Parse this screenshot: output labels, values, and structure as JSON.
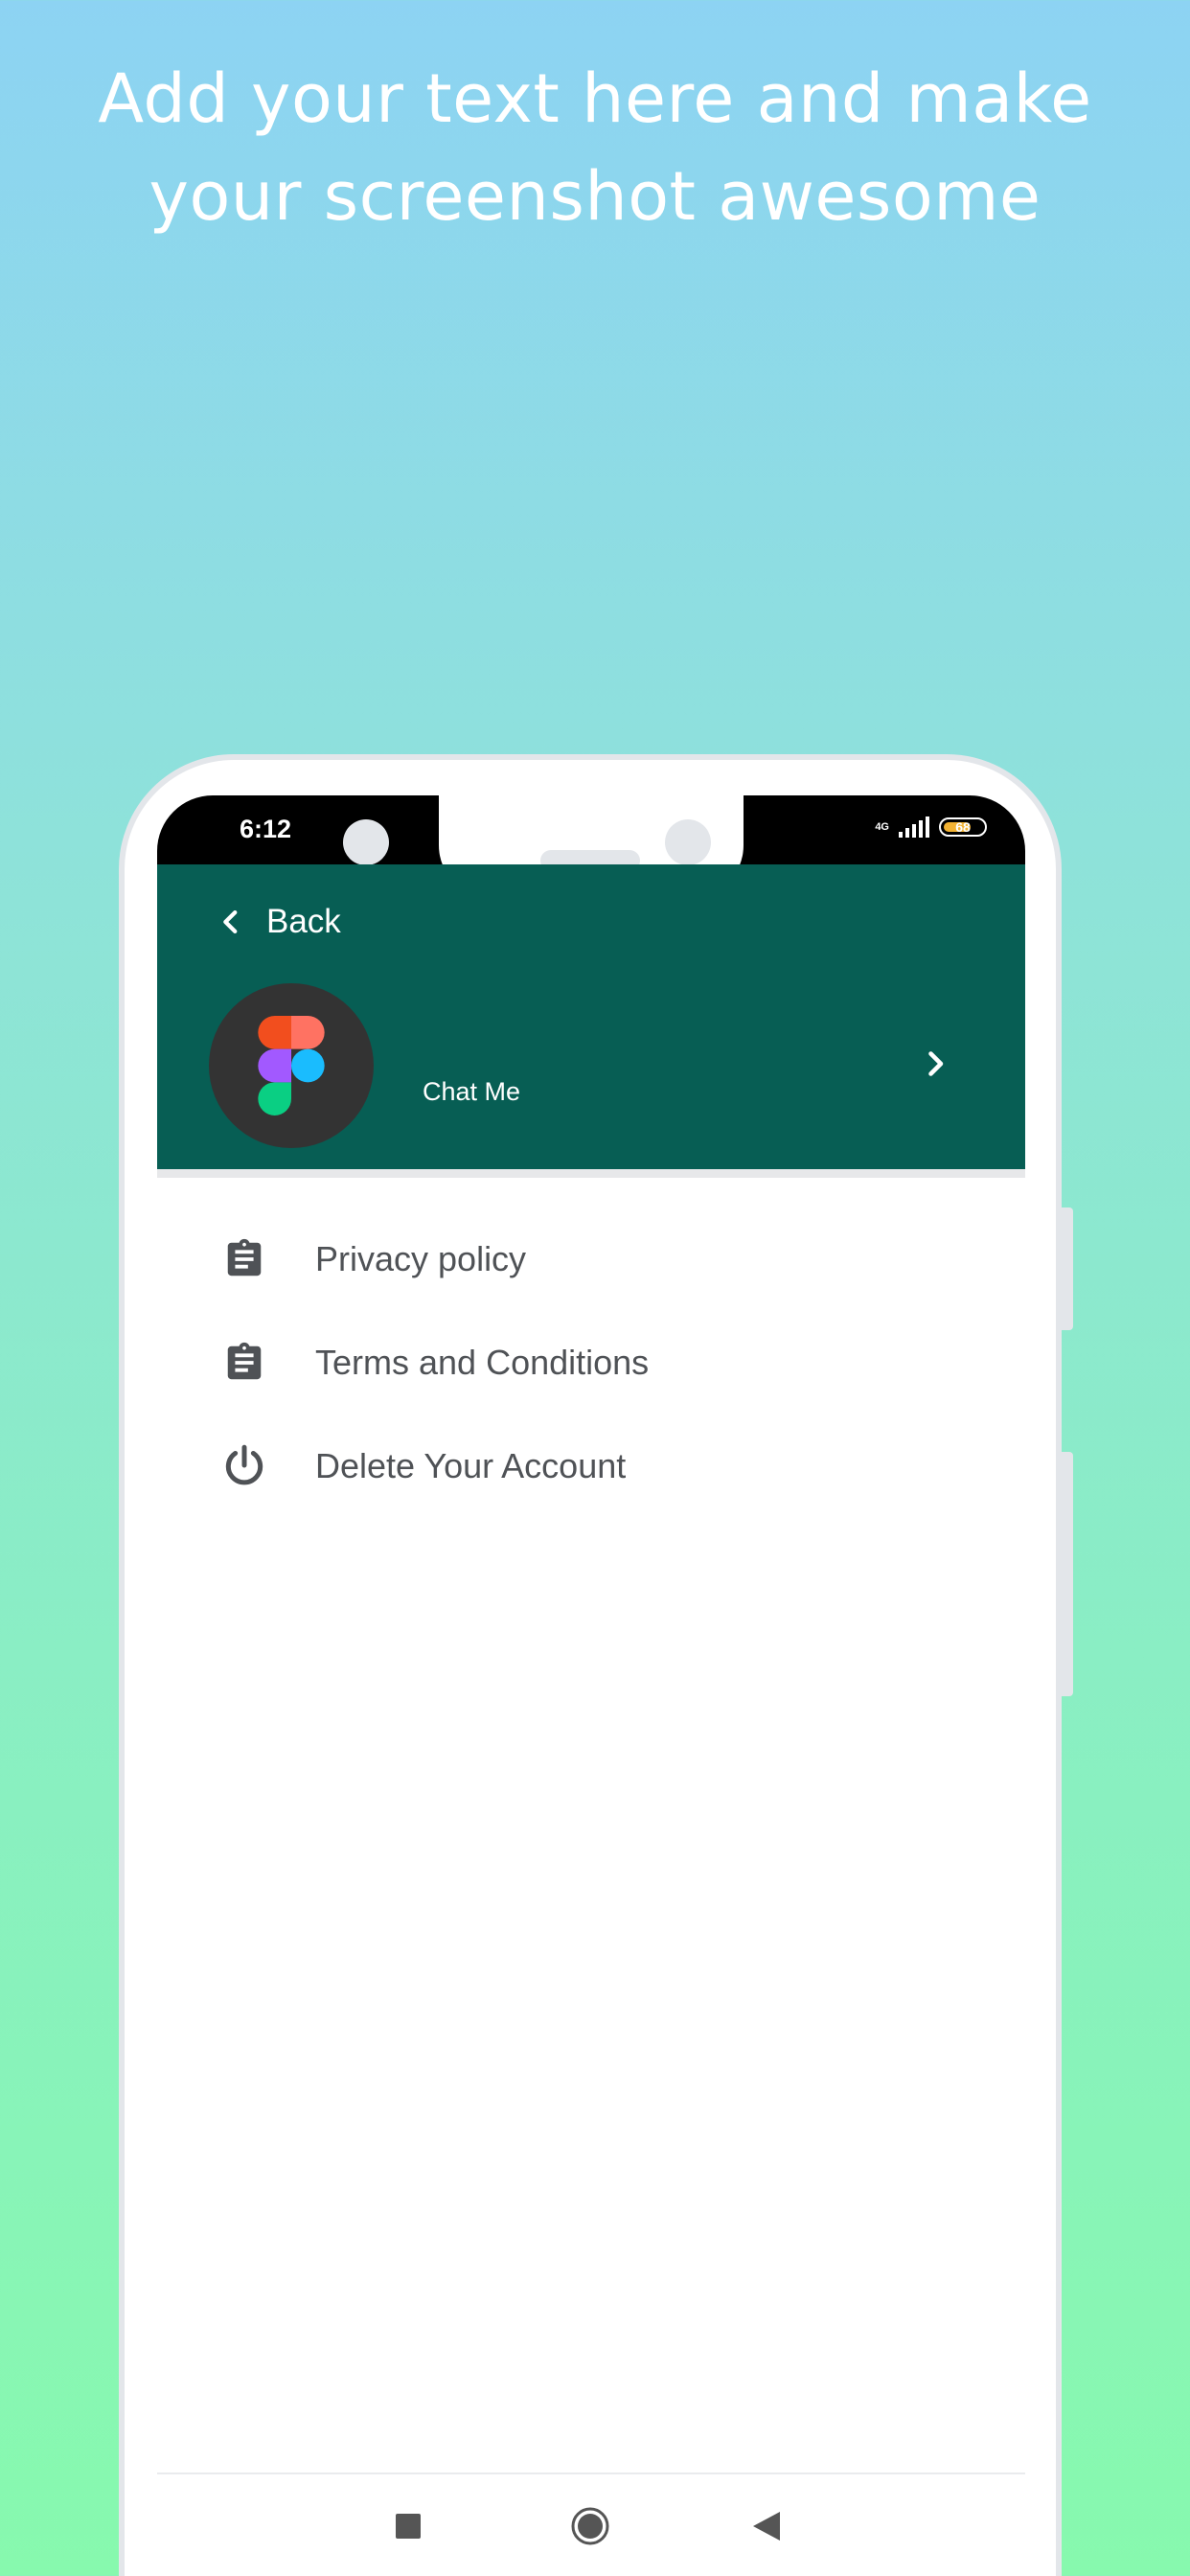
{
  "headline": {
    "line1": "Add your text here and make",
    "line2": "your screenshot awesome"
  },
  "status_bar": {
    "time": "6:12",
    "network": "4G",
    "battery": "68"
  },
  "header": {
    "back_label": "Back",
    "profile_name": "Chat Me",
    "background_color": "#075e54"
  },
  "menu": {
    "items": [
      {
        "label": "Privacy policy",
        "icon": "clipboard-icon"
      },
      {
        "label": "Terms and Conditions",
        "icon": "clipboard-icon"
      },
      {
        "label": "Delete Your Account",
        "icon": "power-icon"
      }
    ]
  },
  "nav_bar": {
    "buttons": [
      "recents-icon",
      "home-icon",
      "back-icon"
    ]
  }
}
